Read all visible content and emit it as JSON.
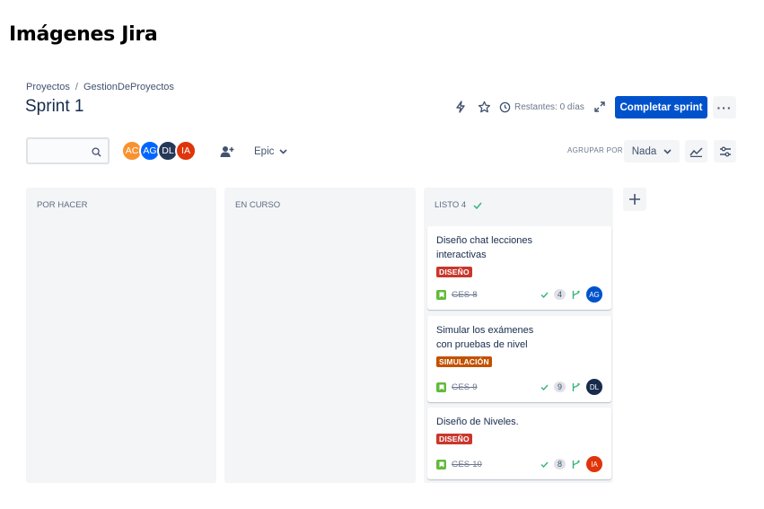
{
  "doc_title": "Imágenes Jira",
  "breadcrumb": {
    "project": "Proyectos",
    "separator": "/",
    "board": "GestionDeProyectos"
  },
  "sprint": {
    "title": "Sprint 1",
    "remaining": "Restantes: 0 días",
    "complete_label": "Completar sprint",
    "more_label": "···"
  },
  "filters": {
    "search_placeholder": "",
    "avatars": [
      {
        "initials": "AC",
        "color": "#f79233"
      },
      {
        "initials": "AG",
        "color": "#0065ff"
      },
      {
        "initials": "DL",
        "color": "#253858"
      },
      {
        "initials": "IA",
        "color": "#de350b"
      }
    ],
    "epic_label": "Epic",
    "group_by_label": "AGRUPAR POR",
    "group_by_value": "Nada"
  },
  "columns": [
    {
      "title": "POR HACER",
      "count": ""
    },
    {
      "title": "EN CURSO",
      "count": ""
    },
    {
      "title": "LISTO 4",
      "count": ""
    }
  ],
  "cards": [
    {
      "title": "Diseño chat lecciones interactivas",
      "label": "DISEÑO",
      "label_color": "#c9372c",
      "key": "GES-8",
      "points": "4",
      "assignee": "AG",
      "assignee_color": "#0052cc"
    },
    {
      "title": "Simular los exámenes con pruebas de nivel",
      "label": "SIMULACIÓN",
      "label_color": "#c25100",
      "key": "GES-9",
      "points": "9",
      "assignee": "DL",
      "assignee_color": "#172b4d"
    },
    {
      "title": "Diseño de Niveles.",
      "label": "DISEÑO",
      "label_color": "#c9372c",
      "key": "GES-10",
      "points": "8",
      "assignee": "IA",
      "assignee_color": "#de350b"
    }
  ],
  "icons": {
    "automation": "lightning-icon",
    "star": "star-icon",
    "clock": "clock-icon",
    "expand": "expand-icon",
    "search": "search-icon",
    "add_person": "add-person-icon",
    "insight": "chart-icon",
    "settings": "sliders-icon",
    "add_column": "plus-icon"
  }
}
